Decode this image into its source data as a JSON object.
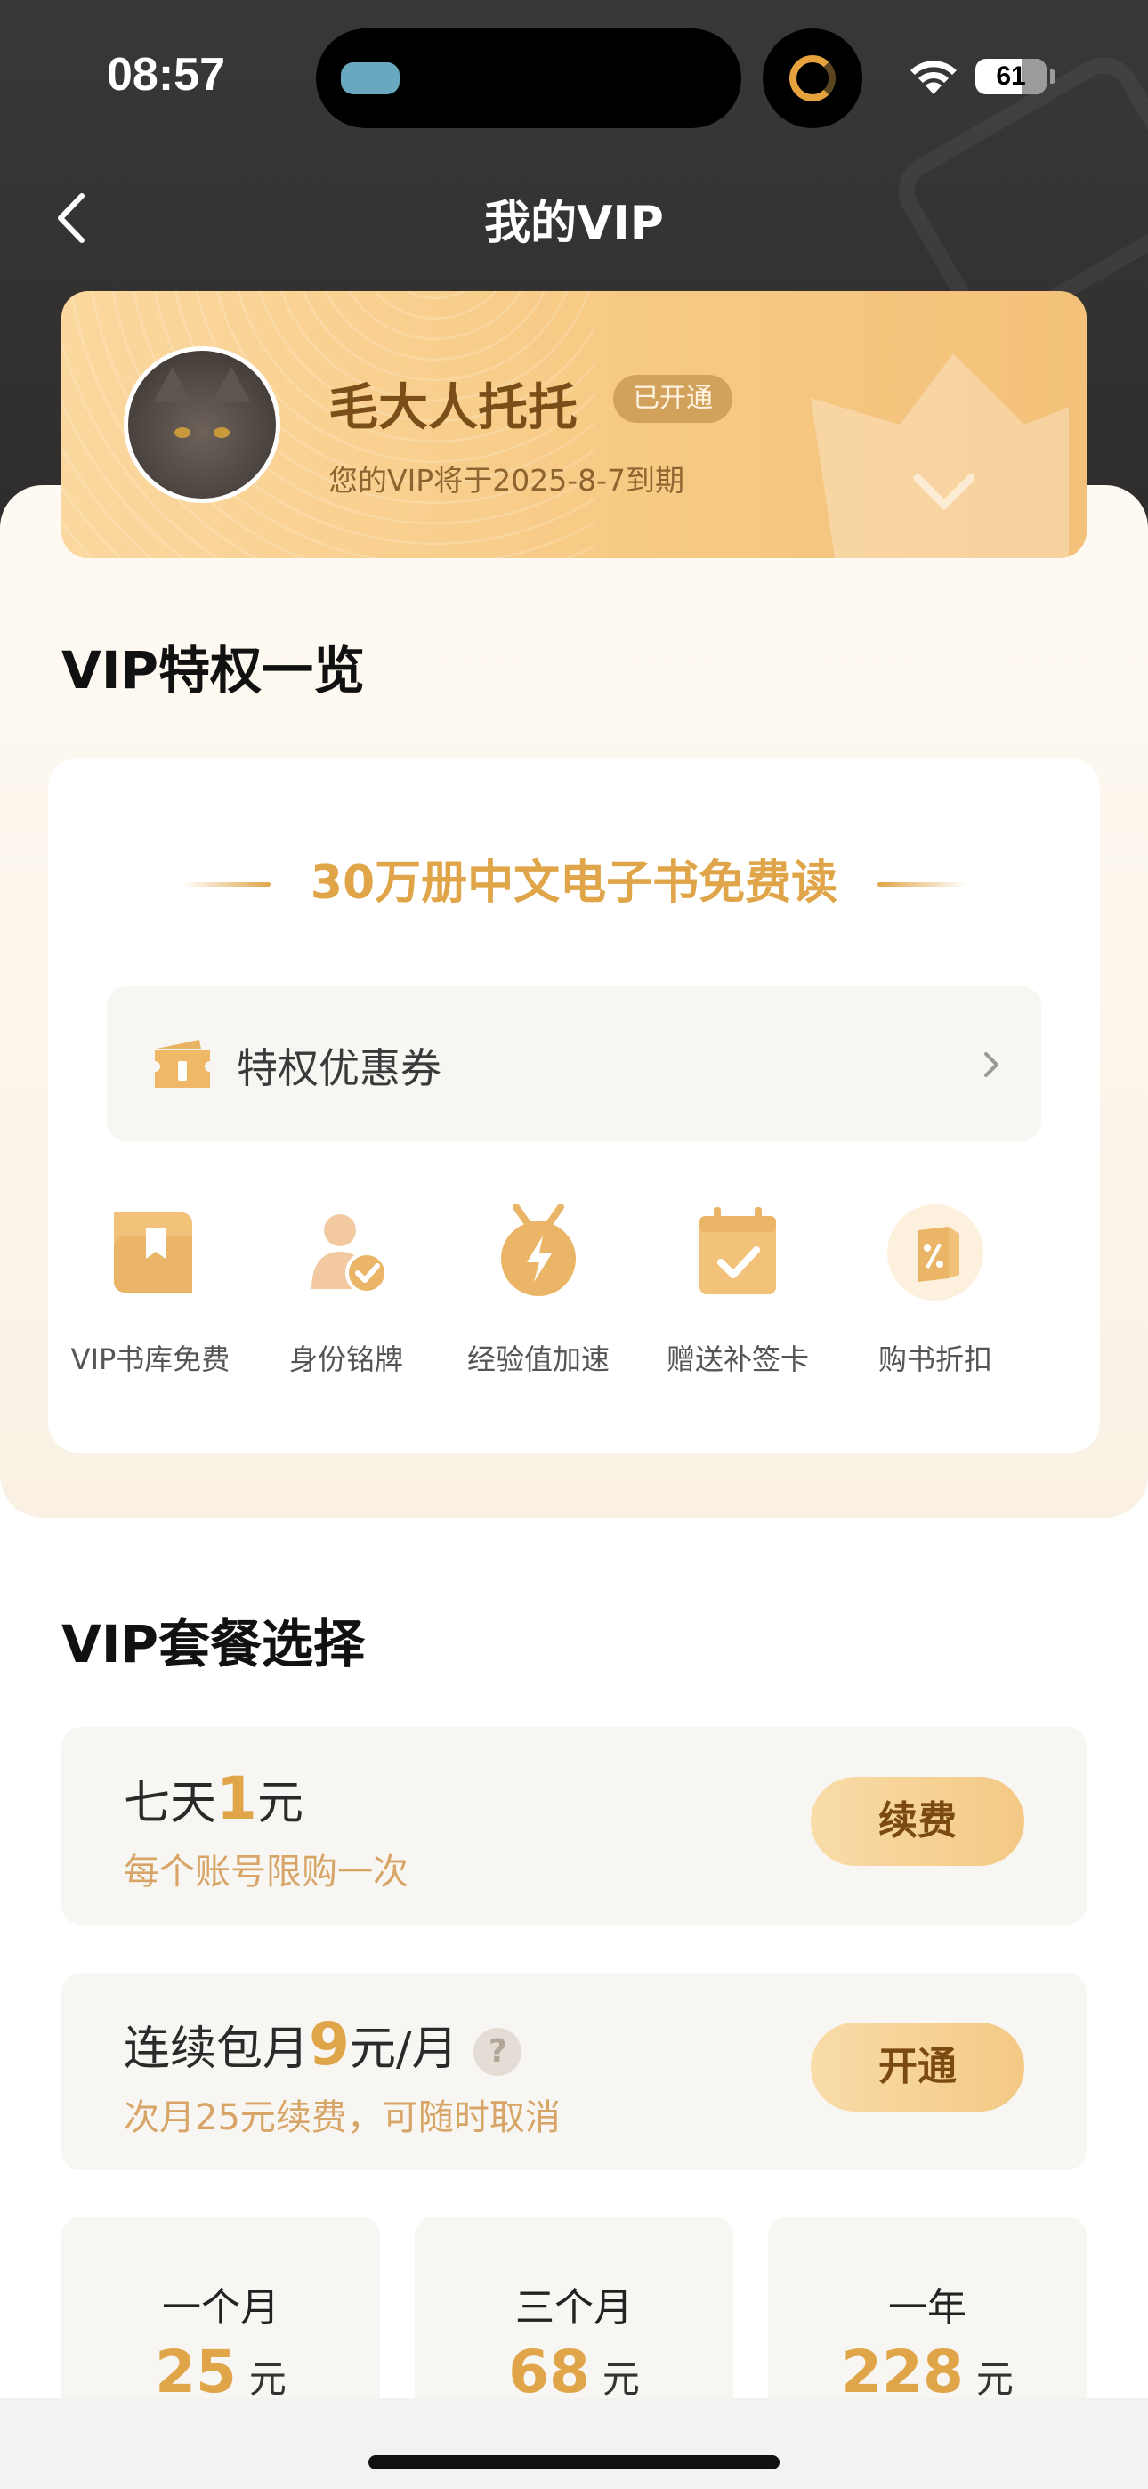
{
  "status_bar": {
    "time": "08:57",
    "battery": "61"
  },
  "nav": {
    "title": "我的VIP"
  },
  "vip_card": {
    "user_name": "毛大人托托",
    "status_badge": "已开通",
    "expire_text": "您的VIP将于2025-8-7到期"
  },
  "privileges": {
    "section_title": "VIP特权一览",
    "headline": "30万册中文电子书免费读",
    "coupon_label": "特权优惠券",
    "items": [
      {
        "label": "VIP书库免费",
        "icon": "bookshelf-icon"
      },
      {
        "label": "身份铭牌",
        "icon": "user-badge-icon"
      },
      {
        "label": "经验值加速",
        "icon": "lightning-medal-icon"
      },
      {
        "label": "赠送补签卡",
        "icon": "calendar-check-icon"
      },
      {
        "label": "购书折扣",
        "icon": "discount-book-icon"
      }
    ]
  },
  "plans": {
    "section_title": "VIP套餐选择",
    "trial": {
      "prefix": "七天",
      "number": "1",
      "suffix": "元",
      "sub": "每个账号限购一次",
      "button": "续费"
    },
    "monthly": {
      "prefix": "连续包月",
      "number": "9",
      "suffix": "元/月",
      "help": "?",
      "sub": "次月25元续费，可随时取消",
      "button": "开通"
    },
    "options": [
      {
        "term": "一个月",
        "price": "25",
        "unit": "元"
      },
      {
        "term": "三个月",
        "price": "68",
        "unit": "元"
      },
      {
        "term": "一年",
        "price": "228",
        "unit": "元"
      }
    ]
  },
  "colors": {
    "accent_gold": "#e0a548",
    "header_dark": "#353332",
    "card_gold": "#f7ca84"
  }
}
